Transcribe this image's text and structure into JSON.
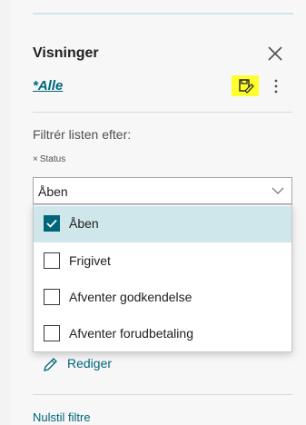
{
  "panel": {
    "title": "Visninger",
    "current_view": "*Alle",
    "icons": {
      "close": "close-icon",
      "save": "save-view-icon",
      "more": "more-vertical-icon"
    },
    "highlight_color": "#ffff2e"
  },
  "filters": {
    "heading": "Filtrér listen efter:",
    "field_chip": {
      "remove_symbol": "×",
      "label": "Status"
    },
    "status_select": {
      "value": "Åben",
      "options": [
        {
          "label": "Åben",
          "checked": true
        },
        {
          "label": "Frigivet",
          "checked": false
        },
        {
          "label": "Afventer godkendelse",
          "checked": false
        },
        {
          "label": "Afventer forudbetaling",
          "checked": false
        }
      ]
    }
  },
  "actions": {
    "edit_label": "Rediger",
    "reset_label": "Nulstil filtre"
  },
  "colors": {
    "accent": "#00657a",
    "selected_row": "#cfe7ea"
  }
}
